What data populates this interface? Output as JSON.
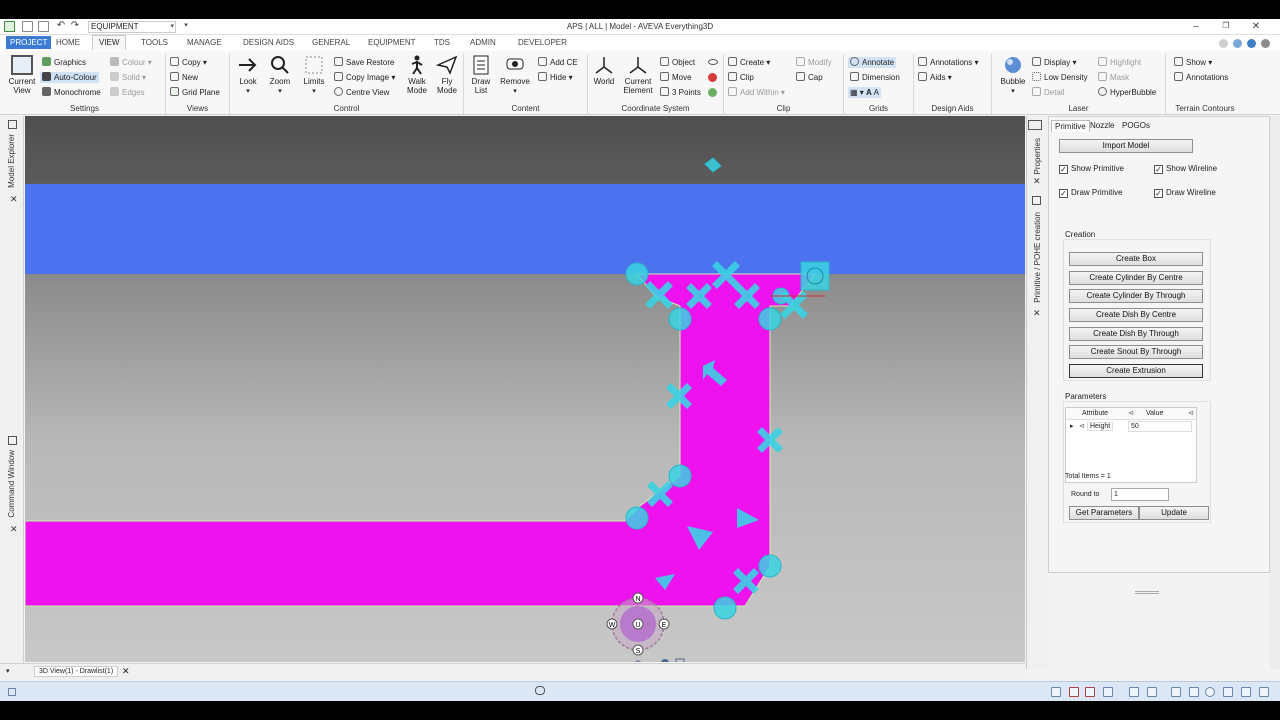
{
  "titlebar": {
    "combo_value": "EQUIPMENT",
    "title": "APS | ALL | Model - AVEVA Everything3D"
  },
  "tabs": [
    "PROJECT",
    "HOME",
    "VIEW",
    "TOOLS",
    "MANAGE",
    "DESIGN AIDS",
    "GENERAL",
    "EQUIPMENT",
    "TDS",
    "ADMIN",
    "DEVELOPER"
  ],
  "ribbon": {
    "settings": {
      "label": "Settings",
      "current_view": "Current\nView",
      "graphics": "Graphics",
      "auto_colour": "Auto-Colour",
      "monochrome": "Monochrome",
      "colour": "Colour",
      "solid": "Solid",
      "edges": "Edges"
    },
    "views": {
      "label": "Views",
      "copy": "Copy",
      "new": "New",
      "grid_plane": "Grid Plane"
    },
    "control": {
      "label": "Control",
      "look": "Look",
      "zoom": "Zoom",
      "limits": "Limits",
      "save_restore": "Save Restore",
      "copy_image": "Copy Image",
      "centre_view": "Centre View",
      "walk_mode": "Walk\nMode",
      "fly_mode": "Fly\nMode"
    },
    "content": {
      "label": "Content",
      "draw_list": "Draw\nList",
      "remove": "Remove",
      "add_ce": "Add CE",
      "hide": "Hide"
    },
    "coordinate": {
      "label": "Coordinate System",
      "world": "World",
      "current_element": "Current\nElement",
      "object": "Object",
      "move": "Move",
      "three_points": "3 Points"
    },
    "clip": {
      "label": "Clip",
      "create": "Create",
      "clip": "Clip",
      "add_within": "Add Within",
      "modify": "Modify",
      "cap": "Cap"
    },
    "grids": {
      "label": "Grids",
      "annotate": "Annotate",
      "dimension": "Dimension"
    },
    "design_aids": {
      "label": "Design Aids",
      "annotations": "Annotations",
      "aids": "Aids"
    },
    "laser": {
      "label": "Laser",
      "bubble": "Bubble",
      "display": "Display",
      "low_density": "Low Density",
      "detail": "Detail",
      "highlight": "Highlight",
      "mask": "Mask",
      "hyperbubble": "HyperBubble"
    },
    "terrain": {
      "label": "Terrain Contours",
      "show": "Show",
      "annotations": "Annotations"
    }
  },
  "left_dock": {
    "model_explorer": "Model Explorer",
    "command_window": "Command Window"
  },
  "right_dock": {
    "properties": "Properties",
    "primitive_creation": "Primitive / POHE creation"
  },
  "panel": {
    "tabs": [
      "Primitive",
      "Nozzle",
      "POGOs"
    ],
    "import_model": "Import Model",
    "show_primitive": "Show Primitive",
    "show_wireline": "Show Wireline",
    "draw_primitive": "Draw Primitive",
    "draw_wireline": "Draw Wireline",
    "creation_label": "Creation",
    "buttons": [
      "Create Box",
      "Create Cylinder By Centre",
      "Create Cylinder By Through",
      "Create Dish By Centre",
      "Create Dish By Through",
      "Create Snout By Through",
      "Create Extrusion"
    ],
    "parameters_label": "Parameters",
    "table_headers": [
      "Attribute",
      "Value"
    ],
    "row_attribute": "Height",
    "row_value": "50",
    "total_items": "Total Items = 1",
    "round_to_label": "Round to",
    "round_to_value": "1",
    "get_parameters": "Get Parameters",
    "update": "Update"
  },
  "viewcube": {
    "n": "N",
    "s": "S",
    "e": "E",
    "w": "W",
    "u": "U"
  },
  "doc_tab": "3D View(1) - Drawlist(1)",
  "colors": {
    "magenta": "#ee12ee",
    "blue": "#4d72f0",
    "cyan": "#39d3e3",
    "accent": "#3b7bd4"
  }
}
